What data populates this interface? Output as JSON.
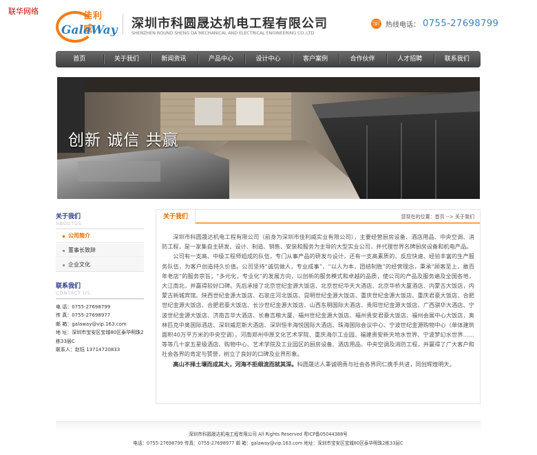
{
  "corner_tag": "联华网络",
  "header": {
    "logo_cn": "佳利威",
    "logo_en": "GalaWay",
    "company_cn": "深圳市科圆晟达机电工程有限公司",
    "company_en": "SHENZHEN ROUND SHENG DA MECHANICAL AND ELECTRICAL ENGINEERING CO.,LTD",
    "hotline_label": "热线电话：",
    "hotline_number": "0755-27698799",
    "accent_color": "#f07d1a"
  },
  "nav": {
    "items": [
      "首页",
      "关于我们",
      "新闻资讯",
      "产品中心",
      "设计中心",
      "客户案例",
      "合作伙伴",
      "人才招聘",
      "联系我们"
    ]
  },
  "banner": {
    "slogan": "创新    诚信    共赢"
  },
  "sidebar": {
    "about_title": "关于我们",
    "about_sub": "ABOUTUS",
    "items": [
      {
        "label": "公司简介",
        "active": true
      },
      {
        "label": "董事长致辞",
        "active": false
      },
      {
        "label": "企业文化",
        "active": false
      }
    ],
    "contact_title": "联系我们",
    "contact_sub": "CONTACT US",
    "contact": {
      "tel": "电 话：0755-27698799",
      "fax": "传 真：0755-27698977",
      "email": "邮 箱：galaway@vip.163.com",
      "address": "地 址：深圳市宝安区宝城80区泰华明珠2栋33层C",
      "person": "联系人：赵钰 13714720833"
    }
  },
  "main": {
    "tab": "关于我们",
    "crumb": "您现在的位置：首页 --> 关于我们",
    "paragraphs": [
      "深圳市科圆晟达机电工程有限公司（前身为深圳市佳利威实业有限公司），主要经营厨房设备、酒店用品、中央空调、消防工程，是一家集自主研发、设计、制造、销售、安装和服务为主导的大型实业公司，并代理世界名牌厨房设备和机电产品。",
      "公司有一支高、中级工程师组成的队伍，专门从事产品的研发与设计，还有一支高素质的、反应快速、经验丰富的生产服务队伍，为客户创造持久价值。公司坚持“诚信做人，专业成事”、“以人为本，团结制胜”的经营理念，秉承“顾客至上，敢百年老店”的服务宗旨；“多元化，专业化”的发展方向，以创新的服务模式和卓越的品质，使公司的产品及服务遍及全国各地，大江南北，并赢得较好口碑。先后承接了北京世纪金源大饭店、北京世纪华天大酒店、北京华桥大厦酒店、内蒙古大饭店，内蒙古新城宾馆、陕西世纪金源大饭店、石家庄河北饭店、昆明世纪金源大饭店、重庆世纪金源大饭店、重庆君豪大饭店、合肥世纪金源大饭店、合肥君豪大饭店、长沙世纪金源大饭店、山西东明国际大酒店、贵阳世纪金源大饭店、广西骐华大酒店、宁波世纪金源大饭店、济南吉华大酒店、长春吉粮大厦、福州世纪金源大饭店、福州贵安君豪大饭店、福州会展中心大饭店，奥林匹克中奥国际酒店、深圳威尼斯大酒店、深圳恒丰海悦国际大酒店、珠海国际会议中心、宁波世纪金源购物中心（单体建筑面积40万平方米的中央空调），河南郑州中原文化艺术学院、重庆海尔工业园、福建贵安新天地水世界、宁波梦幻水世界……等等几十家五星级酒店、购物中心、艺术学院及工业园区的厨房设备、酒店用品、中央空调及消防工程，并赢得了广大客户和社会各界的肯定与赞誉，树立了良好的口碑及业界形象。"
    ],
    "quote_bold": "高山不择土壤而成其大，河海不拒细流而就其深。",
    "quote_rest": "科圆晟达人秉诚明责与社会各界同仁携手共进，同创辉煌明天。"
  },
  "footer": {
    "line1": "深圳市科圆晟达机电工程有限公司 All Rights Reserved  粤ICP备05044388号",
    "line2": "电话：0755-27698799 传真：0755-27698977 邮 箱：galaway@vip.163.com 地址：深圳市宝安区宝城80区泰华明珠2栋33层C"
  }
}
